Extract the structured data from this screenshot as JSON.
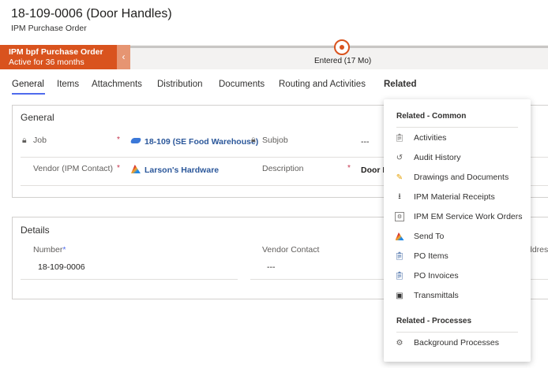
{
  "header": {
    "title": "18-109-0006 (Door Handles)",
    "subtitle": "IPM Purchase Order"
  },
  "bpf": {
    "name": "IPM bpf Purchase Order",
    "active_for": "Active for 36 months",
    "stage": "Entered  (17 Mo)"
  },
  "tabs": [
    {
      "label": "General"
    },
    {
      "label": "Items"
    },
    {
      "label": "Attachments"
    },
    {
      "label": "Distribution"
    },
    {
      "label": "Documents"
    },
    {
      "label": "Routing and Activities"
    },
    {
      "label": "Related"
    }
  ],
  "general": {
    "title": "General",
    "job_label": "Job",
    "job_value": "18-109 (SE Food Warehouse)",
    "subjob_label": "Subjob",
    "subjob_value": "---",
    "vendor_label": "Vendor (IPM Contact)",
    "vendor_value": "Larson's Hardware",
    "description_label": "Description",
    "description_value": "Door H",
    "required": "*"
  },
  "details": {
    "title": "Details",
    "number_label": "Number",
    "number_value": "18-109-0006",
    "vendor_contact_label": "Vendor Contact",
    "vendor_contact_value": "---",
    "address_label": "ddres"
  },
  "related_menu": {
    "common_header": "Related - Common",
    "items": [
      {
        "label": "Activities",
        "icon": "activities-icon"
      },
      {
        "label": "Audit History",
        "icon": "history-icon"
      },
      {
        "label": "Drawings and Documents",
        "icon": "pencil-icon"
      },
      {
        "label": "IPM Material Receipts",
        "icon": "receipt-icon"
      },
      {
        "label": "IPM EM Service Work Orders",
        "icon": "work-order-icon"
      },
      {
        "label": "Send To",
        "icon": "send-to-icon"
      },
      {
        "label": "PO Items",
        "icon": "po-items-icon"
      },
      {
        "label": "PO Invoices",
        "icon": "po-invoices-icon"
      },
      {
        "label": "Transmittals",
        "icon": "transmittal-icon"
      }
    ],
    "processes_header": "Related - Processes",
    "process_items": [
      {
        "label": "Background Processes",
        "icon": "background-process-icon"
      }
    ]
  },
  "colors": {
    "accent": "#d9531e",
    "tab_underline": "#4f6bed",
    "link": "#2b579a"
  }
}
